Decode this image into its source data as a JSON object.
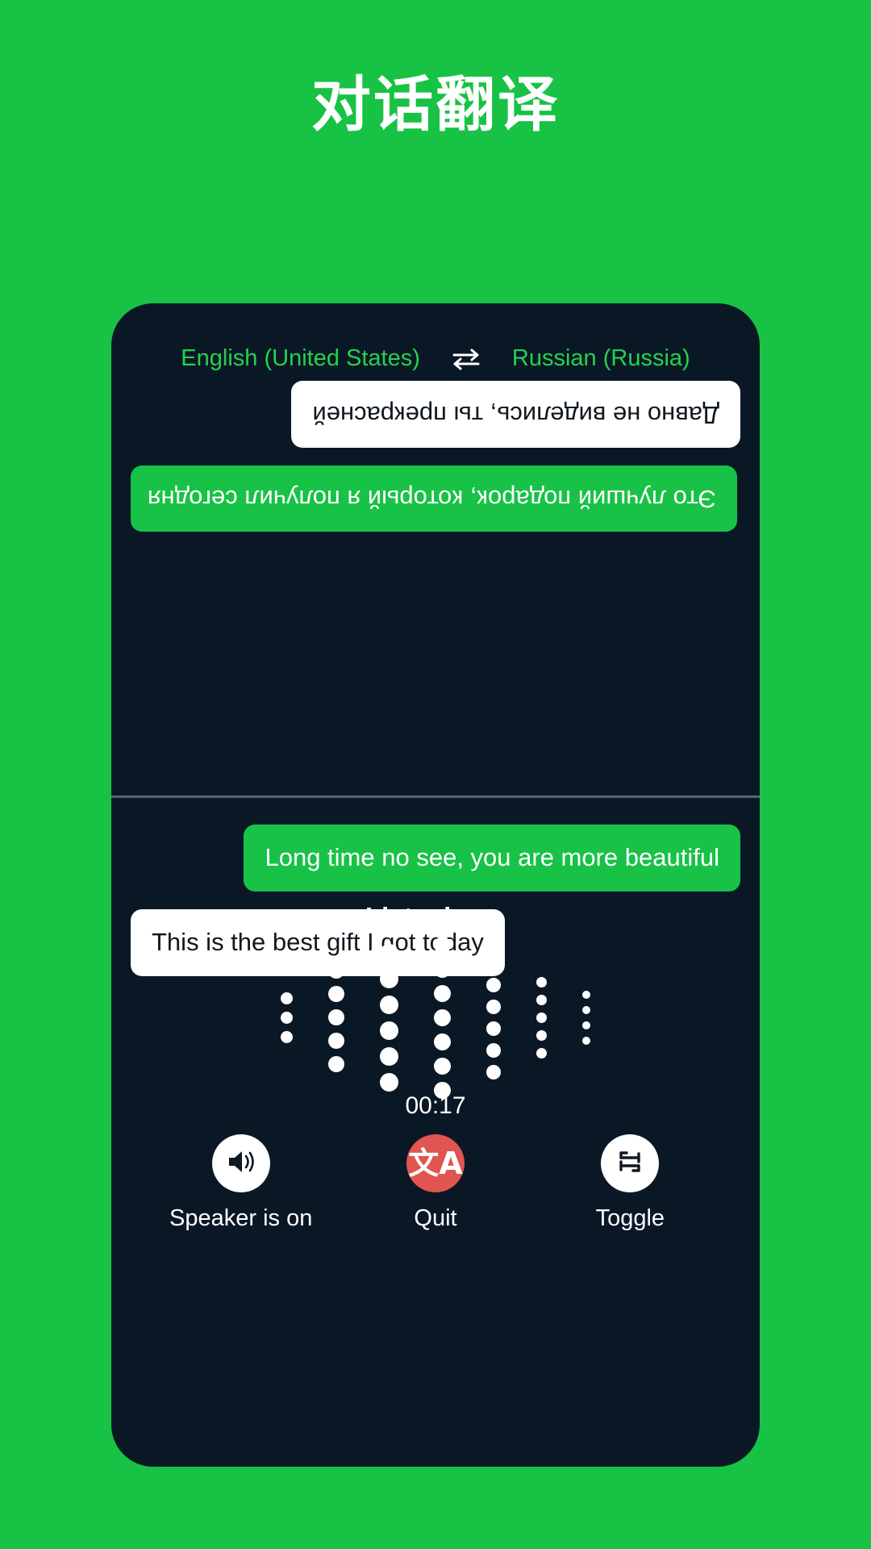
{
  "page": {
    "title": "对话翻译",
    "background_color": "#18c244",
    "panel_color": "#0a1826",
    "accent_green": "#18c246",
    "accent_green_text": "#24d24f",
    "quit_red": "#e0554f"
  },
  "language_bar": {
    "source_language": "English (United States)",
    "target_language": "Russian (Russia)",
    "swap_icon": "swap-horizontal-icon"
  },
  "conversation": {
    "top_pane_rotated": true,
    "top_messages": [
      {
        "text": "Это лучший подарок, который я получил сегодня",
        "style": "green",
        "align": "right"
      },
      {
        "text": "Давно не виделись, ты прекрасней",
        "style": "white",
        "align": "left"
      }
    ],
    "bottom_messages": [
      {
        "text": "Long time no see, you are more beautiful",
        "style": "green",
        "align": "right"
      },
      {
        "text": "This is the best gift I got today",
        "style": "white",
        "align": "left"
      }
    ]
  },
  "recording": {
    "status_text": "Listening...",
    "timer": "00:17",
    "waveform": {
      "columns": [
        {
          "count": 3,
          "size": 15
        },
        {
          "count": 5,
          "size": 20
        },
        {
          "count": 6,
          "size": 23
        },
        {
          "count": 7,
          "size": 21
        },
        {
          "count": 6,
          "size": 18
        },
        {
          "count": 5,
          "size": 13
        },
        {
          "count": 4,
          "size": 10
        }
      ]
    }
  },
  "actions": [
    {
      "label": "Speaker is on",
      "icon": "speaker-on-icon",
      "style": "white"
    },
    {
      "label": "Quit",
      "icon": "translate-icon",
      "style": "red"
    },
    {
      "label": "Toggle",
      "icon": "toggle-repeat-icon",
      "style": "white"
    }
  ]
}
